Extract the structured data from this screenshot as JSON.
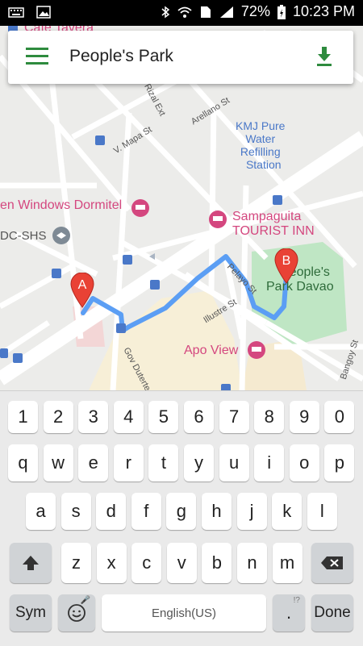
{
  "status_bar": {
    "battery": "72%",
    "time": "10:23 PM"
  },
  "search_card": {
    "title": "People's Park"
  },
  "map": {
    "labels": {
      "cafe": "Cafe Tavera",
      "kmj": [
        "KMJ Pure",
        "Water",
        "Refilling",
        "Station"
      ],
      "windows": "en Windows Dormitel",
      "sampaguita": [
        "Sampaguita",
        "TOURIST INN"
      ],
      "dcshs": "DC-SHS",
      "peoples_park": [
        "People's",
        "Park Davao"
      ],
      "apo_view": "Apo View"
    },
    "streets": {
      "v_mapa": "V. Mapa St",
      "arellano": "Arellano St",
      "pelayo": "Pelayo St",
      "illustre": "Illustre St",
      "gov_duterte": "Gov Duterte",
      "bangoy": "Bangoy St",
      "rizal_ext": "Rizal Ext"
    },
    "markers": {
      "a": "A",
      "b": "B"
    },
    "colors": {
      "route": "#5b9ef4",
      "marker": "#e94235",
      "park": "#bfe6c4"
    }
  },
  "keyboard": {
    "numbers": [
      "1",
      "2",
      "3",
      "4",
      "5",
      "6",
      "7",
      "8",
      "9",
      "0"
    ],
    "row1": [
      "q",
      "w",
      "e",
      "r",
      "t",
      "y",
      "u",
      "i",
      "o",
      "p"
    ],
    "row2": [
      "a",
      "s",
      "d",
      "f",
      "g",
      "h",
      "j",
      "k",
      "l"
    ],
    "row3": [
      "z",
      "x",
      "c",
      "v",
      "b",
      "n",
      "m"
    ],
    "sym": "Sym",
    "space": "English(US)",
    "period": ".",
    "period_hint": "!?",
    "done": "Done"
  }
}
